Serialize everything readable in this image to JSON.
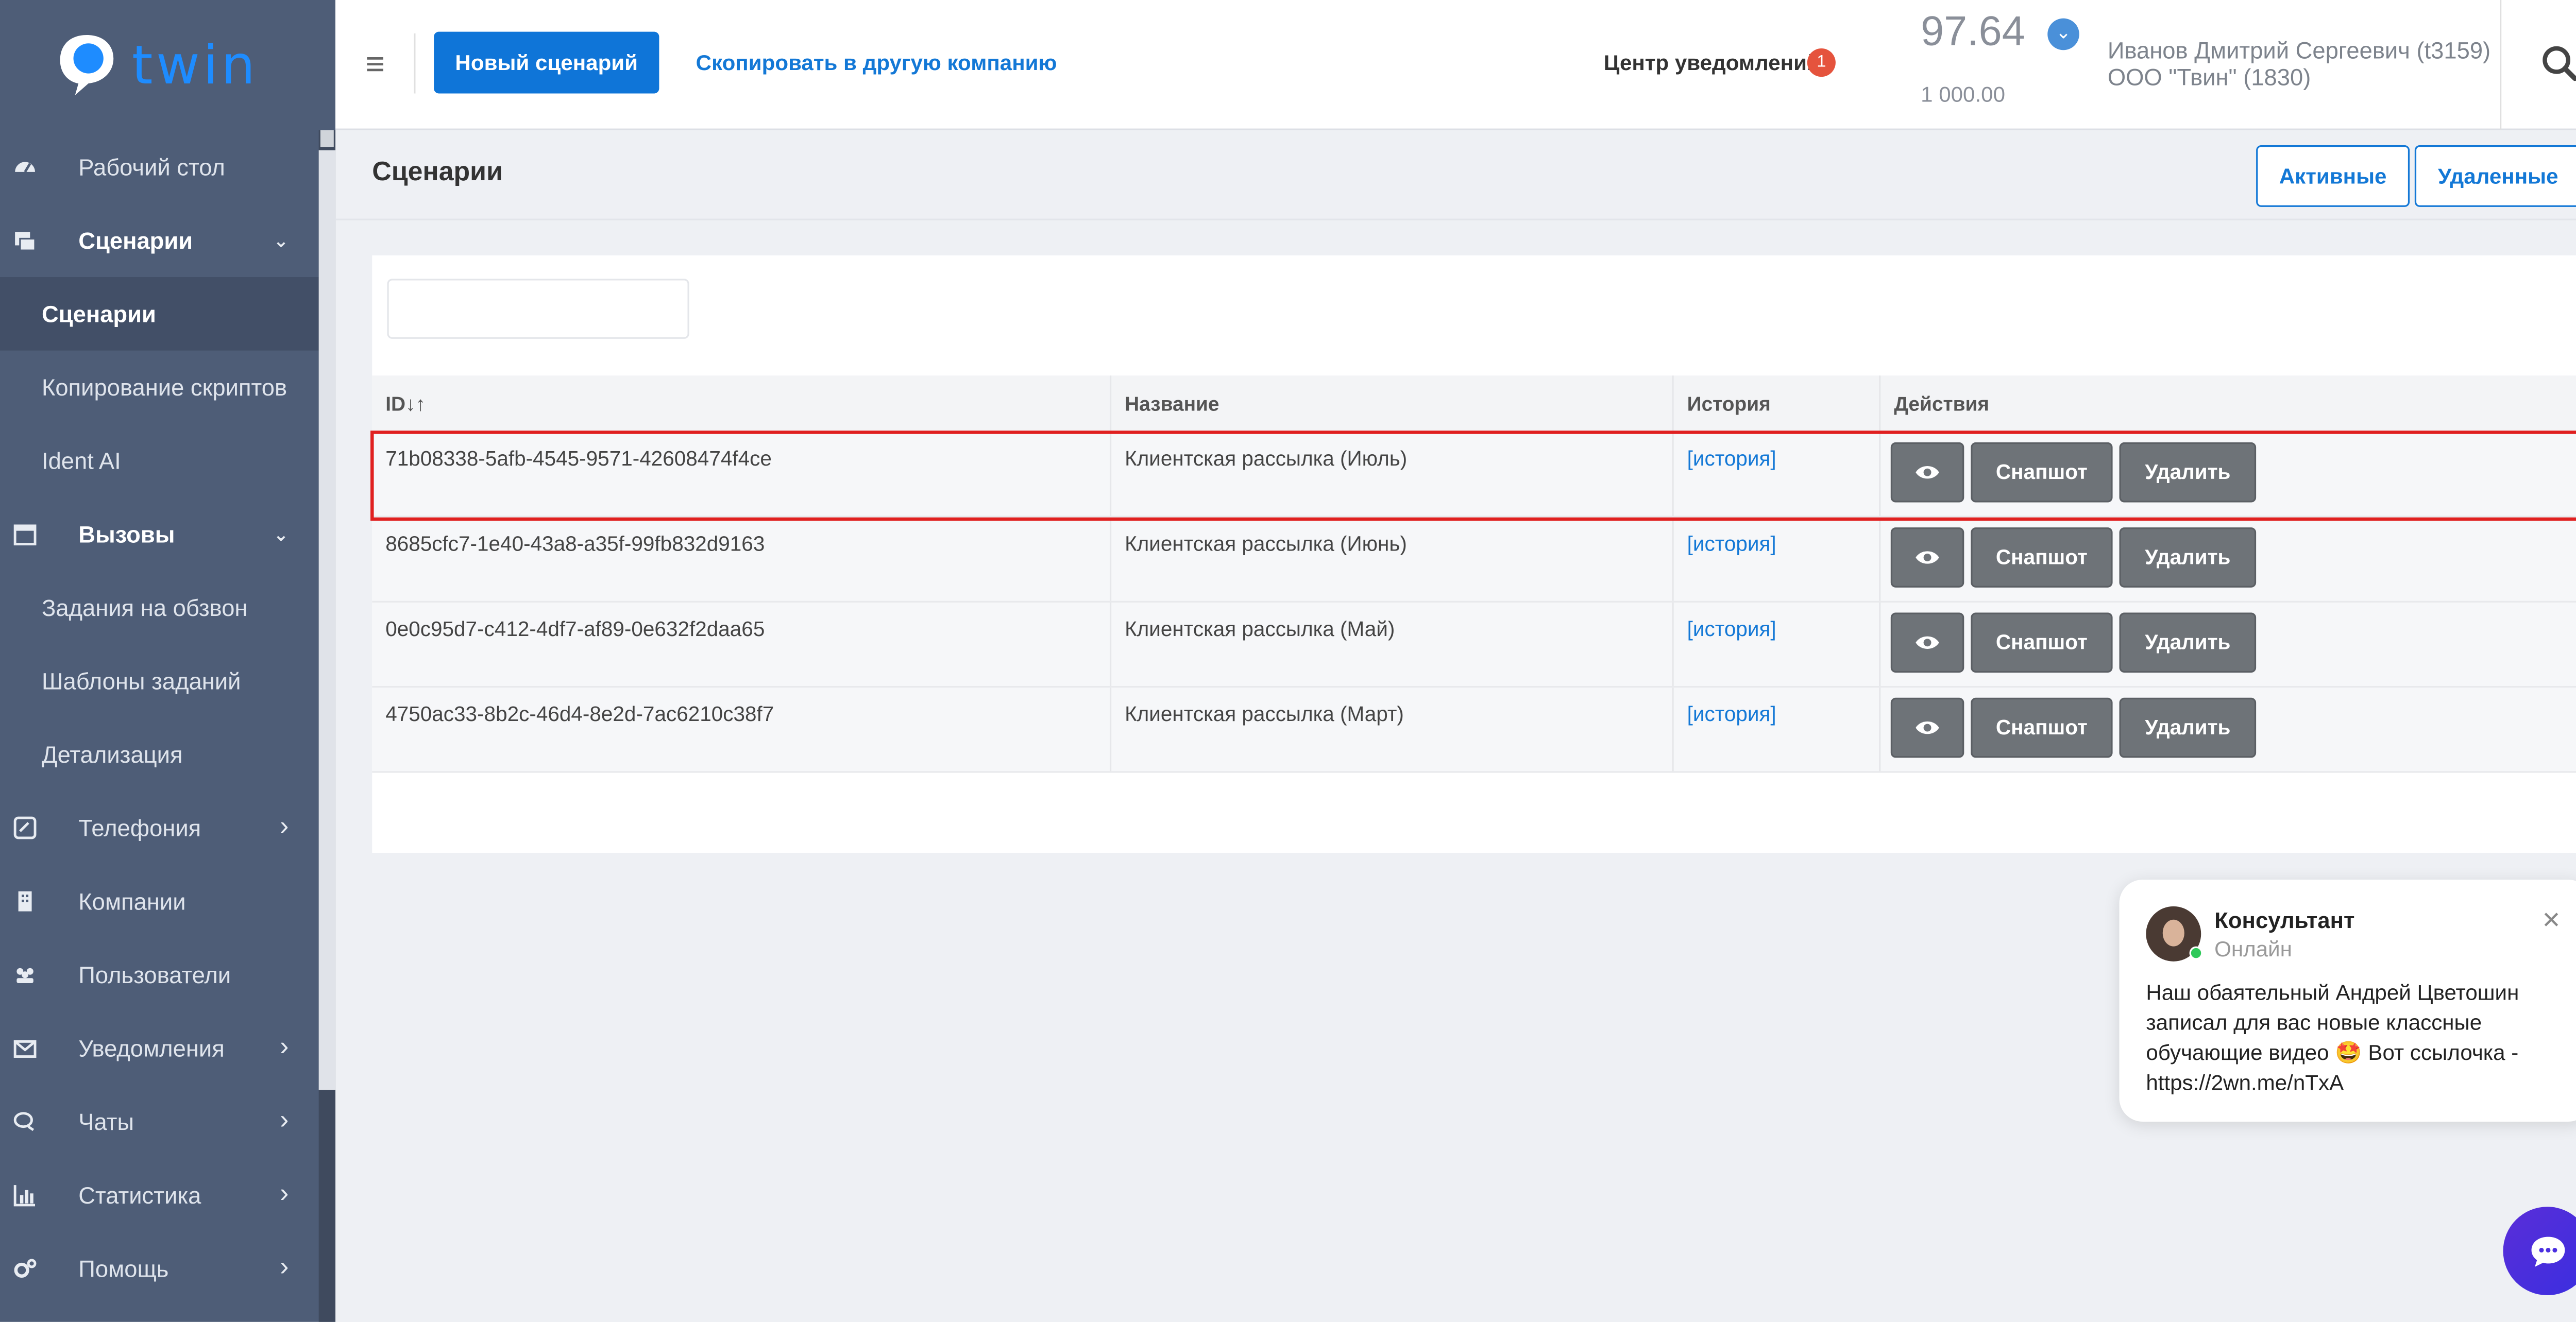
{
  "app": {
    "logo_text": "twin"
  },
  "sidebar": {
    "items": [
      {
        "label": "Рабочий стол",
        "icon": "dashboard-icon",
        "type": "parent"
      },
      {
        "label": "Сценарии",
        "icon": "scenarios-icon",
        "type": "parent",
        "expanded": true
      },
      {
        "label": "Сценарии",
        "type": "sub",
        "active": true
      },
      {
        "label": "Копирование скриптов",
        "type": "sub"
      },
      {
        "label": "Ident AI",
        "type": "sub"
      },
      {
        "label": "Вызовы",
        "icon": "calendar-icon",
        "type": "parent",
        "expanded": true
      },
      {
        "label": "Задания на обзвон",
        "type": "sub"
      },
      {
        "label": "Шаблоны заданий",
        "type": "sub"
      },
      {
        "label": "Детализация",
        "type": "sub"
      },
      {
        "label": "Телефония",
        "icon": "phone-icon",
        "type": "parent"
      },
      {
        "label": "Компании",
        "icon": "building-icon",
        "type": "parent"
      },
      {
        "label": "Пользователи",
        "icon": "users-icon",
        "type": "parent"
      },
      {
        "label": "Уведомления",
        "icon": "envelope-icon",
        "type": "parent"
      },
      {
        "label": "Чаты",
        "icon": "chats-icon",
        "type": "parent"
      },
      {
        "label": "Статистика",
        "icon": "chart-icon",
        "type": "parent"
      },
      {
        "label": "Помощь",
        "icon": "gears-icon",
        "type": "parent"
      }
    ]
  },
  "topbar": {
    "new_scenario": "Новый сценарий",
    "copy_link": "Скопировать в другую компанию",
    "notifications_label": "Центр уведомлений",
    "notifications_count": "1",
    "balance": "97.64",
    "credit": "1 000.00",
    "user_name": "Иванов Дмитрий Сергеевич (t3159)",
    "user_company": "ООО \"Твин\" (1830)"
  },
  "page": {
    "title": "Сценарии",
    "tab_active": "Активные",
    "tab_deleted": "Удаленные"
  },
  "table": {
    "columns": [
      "ID↓↑",
      "Название",
      "История",
      "Действия"
    ],
    "rows": [
      {
        "id": "71b08338-5afb-4545-9571-42608474f4ce",
        "name": "Клиентская рассылка (Июль)",
        "history": "[история]"
      },
      {
        "id": "8685cfc7-1e40-43a8-a35f-99fb832d9163",
        "name": "Клиентская рассылка (Июнь)",
        "history": "[история]"
      },
      {
        "id": "0e0c95d7-c412-4df7-af89-0e632f2daa65",
        "name": "Клиентская рассылка (Май)",
        "history": "[история]"
      },
      {
        "id": "4750ac33-8b2c-46d4-8e2d-7ac6210c38f7",
        "name": "Клиентская рассылка (Март)",
        "history": "[история]"
      }
    ],
    "actions": {
      "snapshot": "Снапшот",
      "delete": "Удалить"
    }
  },
  "chat": {
    "name": "Консультант",
    "status": "Онлайн",
    "message": "Наш обаятельный Андрей Цветошин записал для вас новые классные обучающие видео 🤩 Вот ссылочка - https://2wn.me/nTxA"
  },
  "colors": {
    "sidebar": "#4e5d77",
    "primary": "#0f75d8",
    "highlight": "#e02020"
  }
}
